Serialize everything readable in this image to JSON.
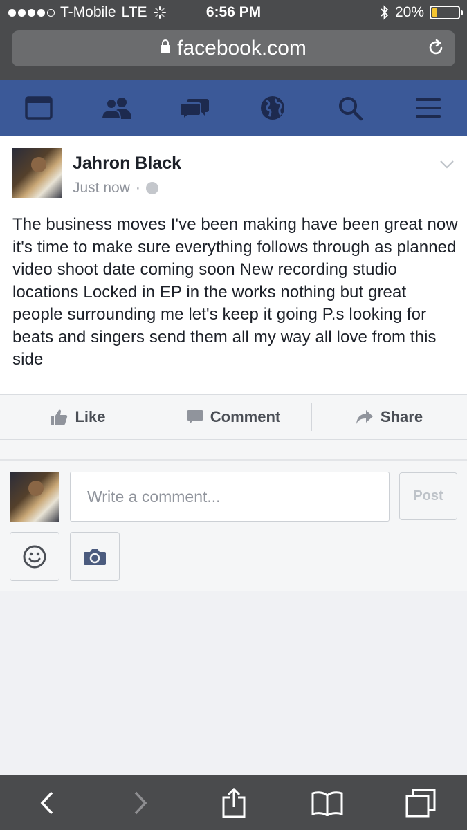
{
  "status_bar": {
    "carrier": "T-Mobile",
    "network": "LTE",
    "time": "6:56 PM",
    "battery": "20%",
    "battery_level": 0.2
  },
  "browser": {
    "url": "facebook.com"
  },
  "fb_nav": {
    "items": [
      "news-feed",
      "friends",
      "messages",
      "notifications",
      "search",
      "menu"
    ]
  },
  "post": {
    "author": "Jahron Black",
    "time": "Just now",
    "separator": "·",
    "body": "The business moves I've been making have been great now it's time to make sure everything follows through as planned video shoot date coming soon New recording studio locations Locked in EP in the works nothing but great people surrounding me let's keep it going P.s looking for beats and singers send them all my way all love from this side"
  },
  "actions": {
    "like": "Like",
    "comment": "Comment",
    "share": "Share"
  },
  "composer": {
    "placeholder": "Write a comment...",
    "post_label": "Post"
  },
  "colors": {
    "fb_blue": "#3b5998",
    "browser_chrome": "#4a4b4d",
    "icon_dark": "#1d2a4f"
  }
}
